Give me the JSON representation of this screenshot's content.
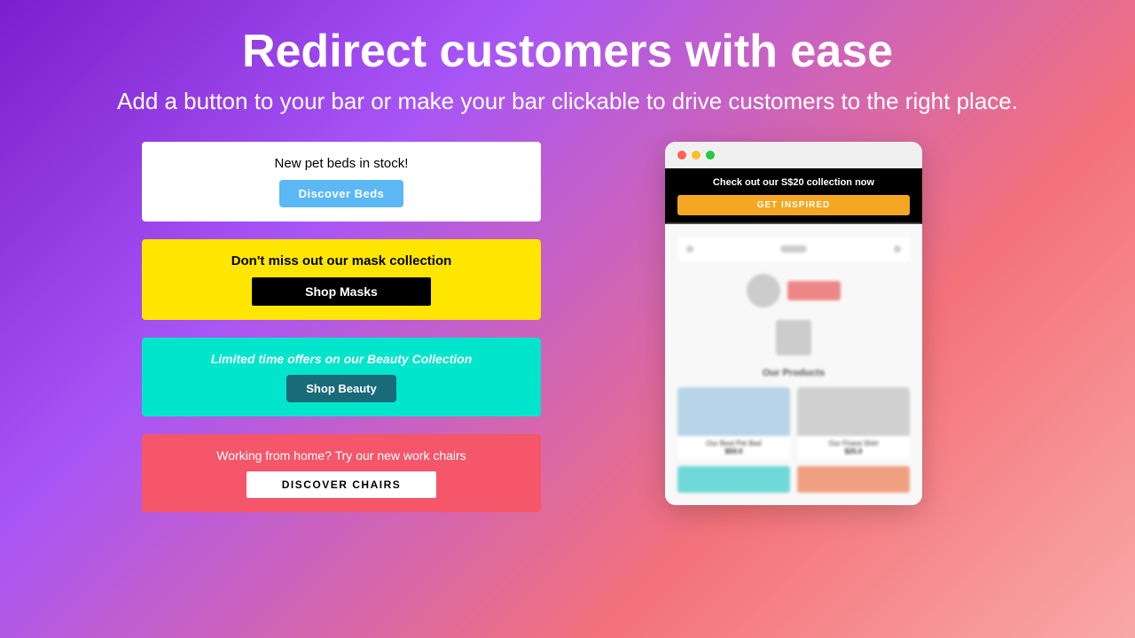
{
  "header": {
    "title": "Redirect customers with ease",
    "subtitle": "Add a button to your bar or make your bar clickable to drive customers to the right place."
  },
  "bars": [
    {
      "id": "bar-pets",
      "bg": "white",
      "text": "New pet beds in stock!",
      "button_label": "Discover Beds",
      "button_style": "blue"
    },
    {
      "id": "bar-masks",
      "bg": "yellow",
      "text": "Don't miss out our mask collection",
      "button_label": "Shop Masks",
      "button_style": "black"
    },
    {
      "id": "bar-beauty",
      "bg": "teal",
      "text": "Limited time offers on our Beauty Collection",
      "button_label": "Shop Beauty",
      "button_style": "dark-teal"
    },
    {
      "id": "bar-chairs",
      "bg": "pink",
      "text": "Working from home? Try our new work chairs",
      "button_label": "DISCOVER CHAIRS",
      "button_style": "white"
    }
  ],
  "browser_mockup": {
    "announcement_text": "Check out our S$20 collection now",
    "announcement_btn": "GET INSPIRED",
    "section_title": "Our Products",
    "products": [
      {
        "name": "Our Best Pet Bed",
        "price": "$59.0"
      },
      {
        "name": "Our Finest Shirt",
        "price": "$25.0"
      }
    ]
  }
}
